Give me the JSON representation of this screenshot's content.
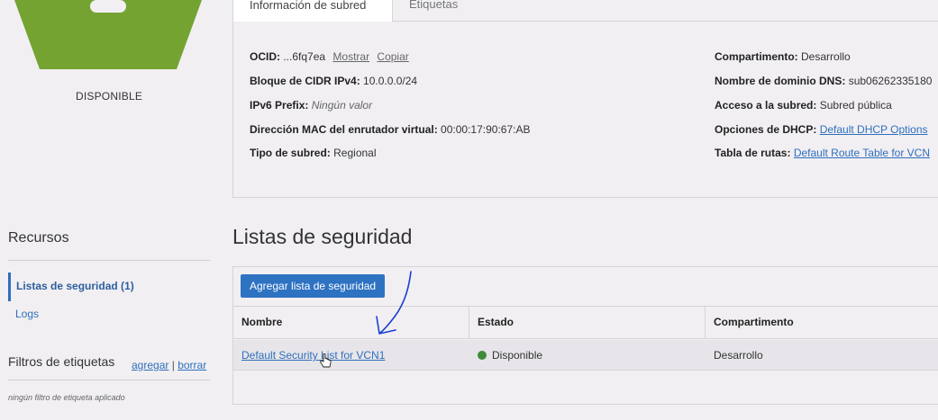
{
  "sidebar": {
    "status": "DISPONIBLE",
    "status_color": "#74a332",
    "resources_title": "Recursos",
    "resources": [
      {
        "label": "Listas de seguridad (1)"
      },
      {
        "label": "Logs"
      }
    ],
    "tag_filters": {
      "title": "Filtros de etiquetas",
      "add": "agregar",
      "separator": "|",
      "clear": "borrar",
      "empty": "ningún filtro de etiqueta aplicado"
    }
  },
  "tabs": [
    {
      "label": "Información de subred"
    },
    {
      "label": "Etiquetas"
    }
  ],
  "subnet_info": {
    "left": [
      {
        "key": "OCID:",
        "value": "...6fq7ea",
        "show": "Mostrar",
        "copy": "Copiar"
      },
      {
        "key": "Bloque de CIDR IPv4:",
        "value": "10.0.0.0/24"
      },
      {
        "key": "IPv6 Prefix:",
        "value": "Ningún valor"
      },
      {
        "key": "Dirección MAC del enrutador virtual:",
        "value": "00:00:17:90:67:AB"
      },
      {
        "key": "Tipo de subred:",
        "value": "Regional"
      }
    ],
    "right": [
      {
        "key": "Compartimento:",
        "value": "Desarrollo"
      },
      {
        "key": "Nombre de dominio DNS:",
        "value": "sub06262335180"
      },
      {
        "key": "Acceso a la subred:",
        "value": "Subred pública"
      },
      {
        "key": "Opciones de DHCP:",
        "value": "Default DHCP Options"
      },
      {
        "key": "Tabla de rutas:",
        "value": "Default Route Table for VCN"
      }
    ]
  },
  "security_lists": {
    "title": "Listas de seguridad",
    "add_button": "Agregar lista de seguridad",
    "columns": [
      "Nombre",
      "Estado",
      "Compartimento"
    ],
    "rows": [
      {
        "name": "Default Security List for VCN1",
        "state": "Disponible",
        "compartment": "Desarrollo"
      }
    ],
    "available_color": "#3f8a3a"
  }
}
